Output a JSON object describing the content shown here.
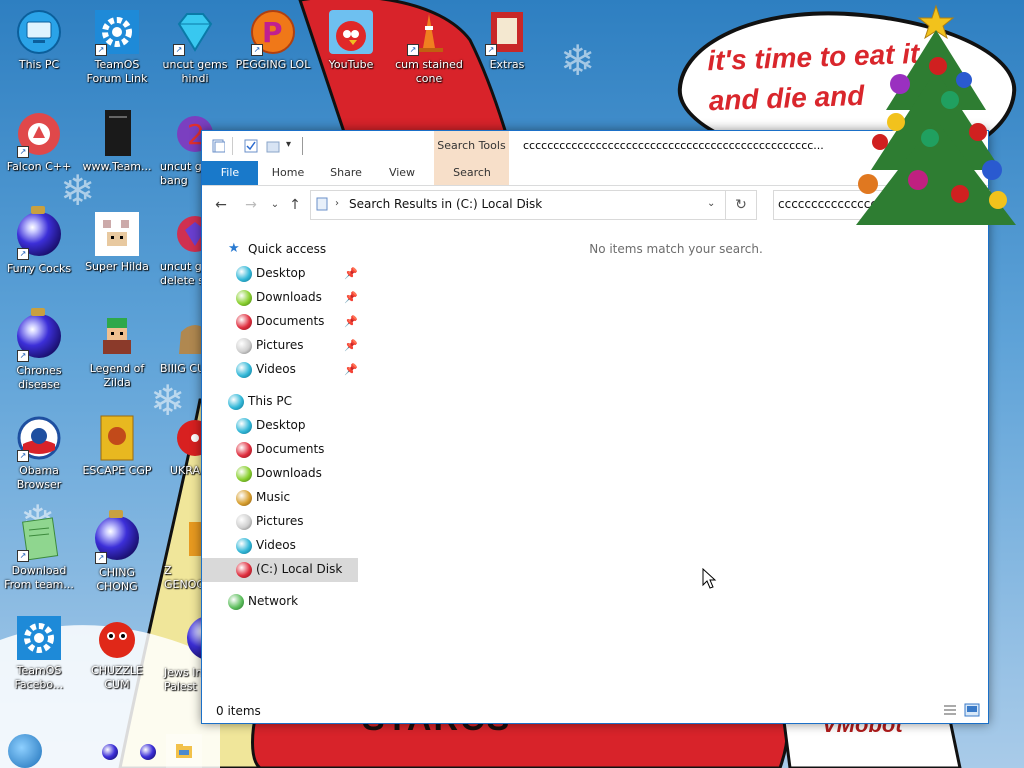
{
  "desktop": {
    "wallpaper_text": "it's time to eat it\nand die and",
    "wallpaper_bottom_text": "STARCS",
    "wallpaper_bottom_right": "VMobot",
    "icons": [
      {
        "id": "this-pc",
        "label": "This PC",
        "icon": "monitor-icon"
      },
      {
        "id": "teamos-forum",
        "label": "TeamOS\nForum Link",
        "icon": "gear-icon"
      },
      {
        "id": "uncut-gems",
        "label": "uncut gems\nhindi",
        "icon": "diamond-icon"
      },
      {
        "id": "pegging",
        "label": "PEGGING LOL",
        "icon": "pegging-icon"
      },
      {
        "id": "youtube",
        "label": "YouTube",
        "icon": "angry-bird-icon"
      },
      {
        "id": "cum-stained",
        "label": "cum stained\ncone",
        "icon": "traffic-cone-icon"
      },
      {
        "id": "extras",
        "label": "Extras",
        "icon": "extras-icon"
      },
      {
        "id": "falcon",
        "label": "Falcon C++",
        "icon": "recycle-icon"
      },
      {
        "id": "www-team",
        "label": "www.Team...",
        "icon": "book-icon"
      },
      {
        "id": "uncut-bang",
        "label": "uncut g\nbang",
        "icon": "number-2-icon"
      },
      {
        "id": "furry",
        "label": "Furry Cocks",
        "icon": "ornament-ball-icon"
      },
      {
        "id": "super-hilda",
        "label": "Super Hilda",
        "icon": "pixel-cat-icon"
      },
      {
        "id": "uncut-delete",
        "label": "uncut g\ndelete s",
        "icon": "gem-icon"
      },
      {
        "id": "chrones",
        "label": "Chrones\ndisease",
        "icon": "ornament-ball-icon"
      },
      {
        "id": "zilda",
        "label": "Legend of\nZilda",
        "icon": "pixel-hero-icon"
      },
      {
        "id": "biiig",
        "label": "BIIIG CU",
        "icon": "bag-icon"
      },
      {
        "id": "obama",
        "label": "Obama\nBrowser",
        "icon": "obama-logo-icon"
      },
      {
        "id": "escape",
        "label": "ESCAPE CGP",
        "icon": "escape-box-icon"
      },
      {
        "id": "ukra",
        "label": "UKRA",
        "icon": "radiation-icon"
      },
      {
        "id": "download-team",
        "label": "Download\nFrom team...",
        "icon": "notepad-icon"
      },
      {
        "id": "ching",
        "label": "CHING\nCHONG",
        "icon": "ornament-ball-icon"
      },
      {
        "id": "genoc",
        "label": "Z\nGENOC",
        "icon": "bricks-icon"
      },
      {
        "id": "teamos-facebook",
        "label": "TeamOS\nFacebo...",
        "icon": "gear-icon"
      },
      {
        "id": "chuzzle",
        "label": "CHUZZLE\nCUM",
        "icon": "chuzzle-icon"
      },
      {
        "id": "jews",
        "label": "Jews In\nPalest",
        "icon": "ornament-ball-icon"
      }
    ]
  },
  "explorer": {
    "title": "cccccccccccccccccccccccccccccccccccccccccccccccc...",
    "context_tab_group": "Search Tools",
    "tabs": [
      "File",
      "Home",
      "Share",
      "View",
      "Search"
    ],
    "address": {
      "breadcrumb": "Search Results in (C:) Local Disk"
    },
    "search_value": "ccccccccccccccc",
    "nav": {
      "quick_access": "Quick access",
      "quick_items": [
        "Desktop",
        "Downloads",
        "Documents",
        "Pictures",
        "Videos"
      ],
      "this_pc": "This PC",
      "pc_items": [
        "Desktop",
        "Documents",
        "Downloads",
        "Music",
        "Pictures",
        "Videos",
        "(C:) Local Disk"
      ],
      "network": "Network"
    },
    "empty_message": "No items match your search.",
    "status": "0 items"
  },
  "colors": {
    "accent": "#1979ca",
    "context_tab": "#f7dfc9",
    "selected_nav": "#d9d9d9"
  }
}
